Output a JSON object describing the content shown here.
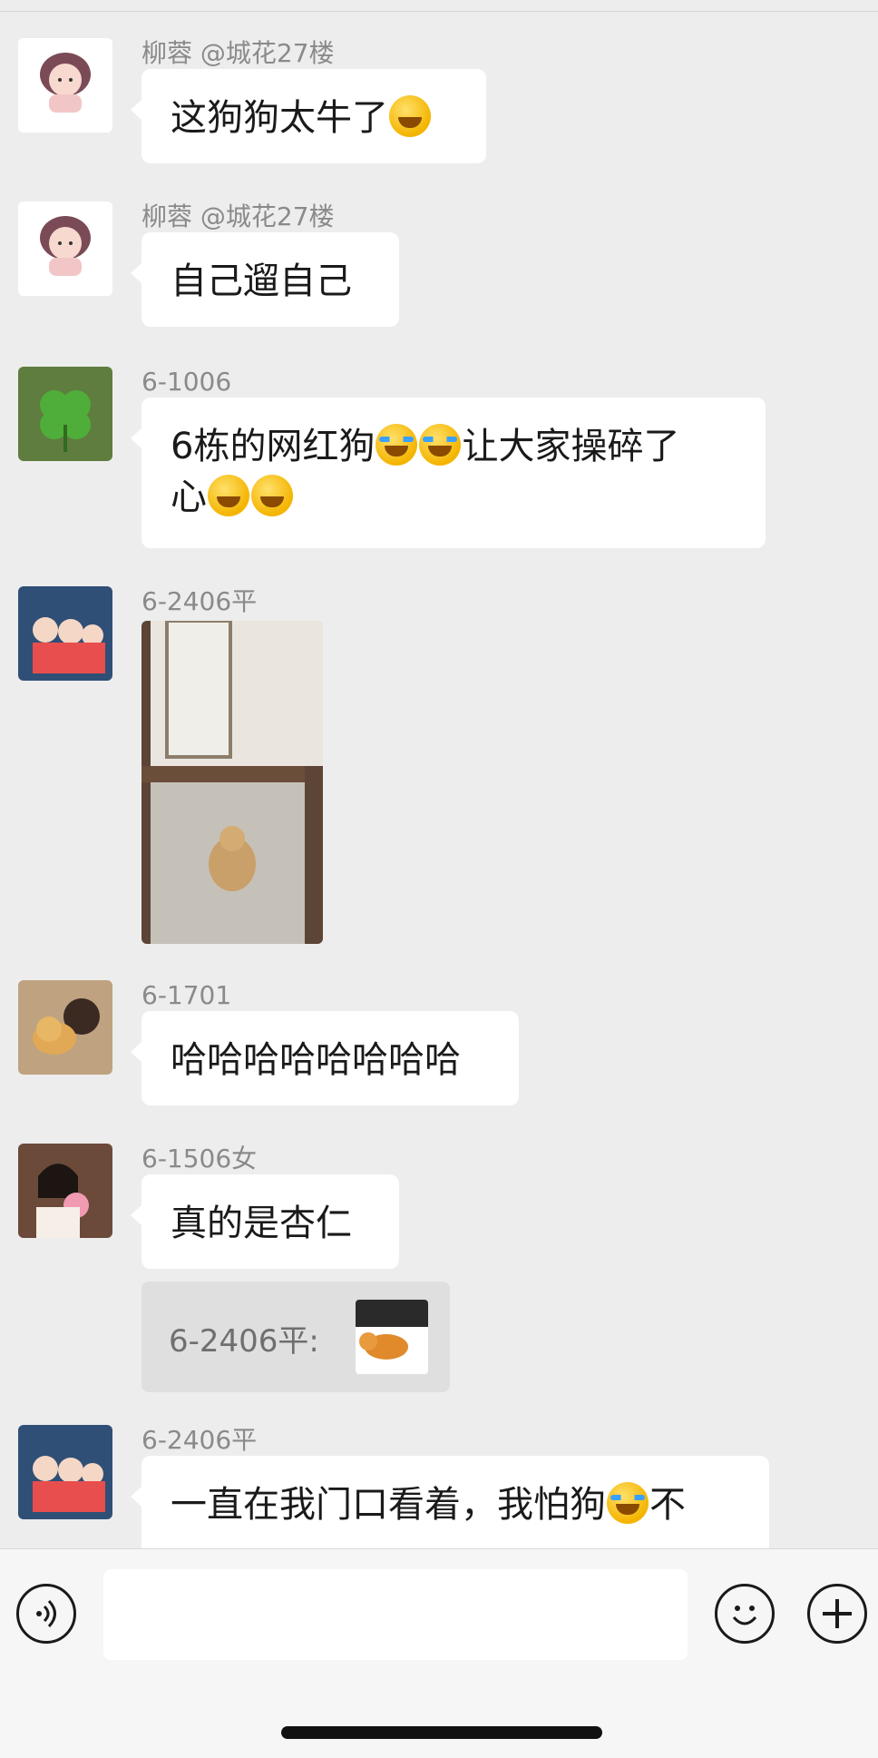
{
  "messages": [
    {
      "sender": "柳蓉 @城花27楼",
      "text_parts": [
        "这狗狗太牛了"
      ]
    },
    {
      "sender": "柳蓉 @城花27楼",
      "text_parts": [
        "自己遛自己"
      ]
    },
    {
      "sender": "6-1006",
      "line1": "6栋的网红狗",
      "line1b": "让大家操碎了",
      "line2": "心"
    },
    {
      "sender": "6-2406平",
      "photo": "dog-at-door-photo"
    },
    {
      "sender": "6-1701",
      "text": "哈哈哈哈哈哈哈哈"
    },
    {
      "sender": "6-1506女",
      "text": "真的是杏仁",
      "quote": {
        "text": "6-2406平:"
      }
    },
    {
      "sender": "6-2406平",
      "text_a": "一直在我门口看着，我怕狗",
      "text_b": "不"
    }
  ],
  "icons": {
    "voice": "voice-icon",
    "emoji": "emoji-icon",
    "plus": "plus-icon"
  },
  "colors": {
    "background": "#ededed",
    "bubble": "#ffffff",
    "sender": "#8a8a8a"
  }
}
